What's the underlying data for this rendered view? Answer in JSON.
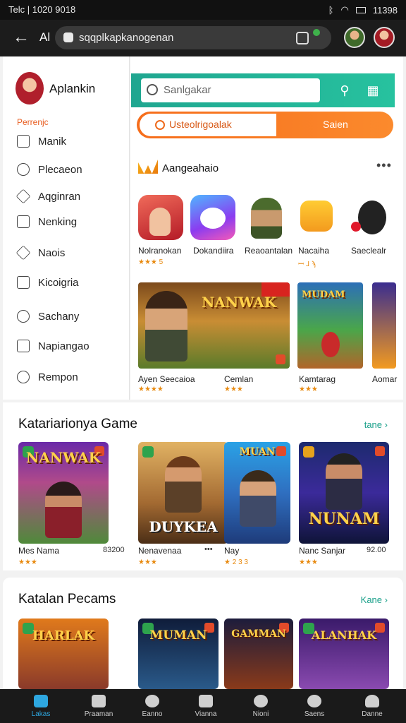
{
  "status": {
    "time": "Telc | 1020 9018",
    "right": "11398"
  },
  "browser": {
    "prefix": "Al",
    "url": "sqqplkapkanogenan"
  },
  "sidebar": {
    "title": "Aplankin",
    "section": "Perrenjc",
    "items": [
      {
        "label": "Manik",
        "icon": "square-icon"
      },
      {
        "label": "Plecaeon",
        "icon": "smiley-icon"
      },
      {
        "label": "Aqginran",
        "icon": "gear-icon"
      },
      {
        "label": "Nenking",
        "icon": "document-icon"
      },
      {
        "label": "Naois",
        "icon": "diamond-icon"
      },
      {
        "label": "Kicoigria",
        "icon": "folder-icon"
      },
      {
        "label": "Sachany",
        "icon": "circle-icon"
      },
      {
        "label": "Napiangao",
        "icon": "square-icon"
      },
      {
        "label": "Rempon",
        "icon": "circle-icon"
      }
    ]
  },
  "search": {
    "placeholder": "Sanlgakar"
  },
  "promo": {
    "input": "Usteolrigoalak",
    "button": "Saien"
  },
  "featured": {
    "title": "Aangeahaio",
    "apps": [
      {
        "name": "Nolranokan",
        "rating": "★★★ 5"
      },
      {
        "name": "Dokandiira",
        "rating": ""
      },
      {
        "name": "Reaoantalan",
        "rating": ""
      },
      {
        "name": "Nacaiha",
        "rating": "ꟷ ⅃ ϡ"
      },
      {
        "name": "Saeclealr",
        "rating": ""
      }
    ],
    "banners": [
      {
        "title": "NANWAK",
        "name": "Ayen Seecaioa",
        "rating": "★★★★"
      },
      {
        "title": "",
        "name": "Cemlan",
        "rating": "★★★"
      },
      {
        "title": "MUDAM",
        "name": "Kamtarag",
        "rating": "★★★"
      },
      {
        "title": "",
        "name": "Aomar",
        "rating": ""
      }
    ]
  },
  "section1": {
    "title": "Katariarionya Game",
    "link": "tane",
    "cards": [
      {
        "title": "NANWAK",
        "name": "Mes Nama",
        "price": "83200",
        "rating": "★★★"
      },
      {
        "title": "DUYKEA",
        "name": "Nenavenaa",
        "price": "•••",
        "rating": "★★★"
      },
      {
        "title": "MUAN",
        "name": "Nay",
        "price": "",
        "rating": "★ 2 3 3"
      },
      {
        "title": "NUNAM",
        "name": "Nanc Sanjar",
        "price": "92.00",
        "rating": "★★★"
      }
    ]
  },
  "section2": {
    "title": "Katalan Pecams",
    "link": "Kane",
    "cards": [
      {
        "title": "HARLAK",
        "name": "",
        "price": "",
        "rating": ""
      },
      {
        "title": "MUMAN",
        "name": "",
        "price": "",
        "rating": ""
      },
      {
        "title": "GAMMAN",
        "name": "",
        "price": "",
        "rating": ""
      },
      {
        "title": "ALANHAK",
        "name": "",
        "price": "",
        "rating": ""
      }
    ]
  },
  "nav": [
    {
      "label": "Lakas",
      "active": true
    },
    {
      "label": "Praaman",
      "active": false
    },
    {
      "label": "Eanno",
      "active": false
    },
    {
      "label": "Vianna",
      "active": false
    },
    {
      "label": "Nioni",
      "active": false
    },
    {
      "label": "Saens",
      "active": false
    },
    {
      "label": "Danne",
      "active": false
    }
  ],
  "colors": {
    "accent_teal": "#27c29f",
    "accent_orange": "#f66d1b",
    "nav_active": "#2ea7e0"
  }
}
